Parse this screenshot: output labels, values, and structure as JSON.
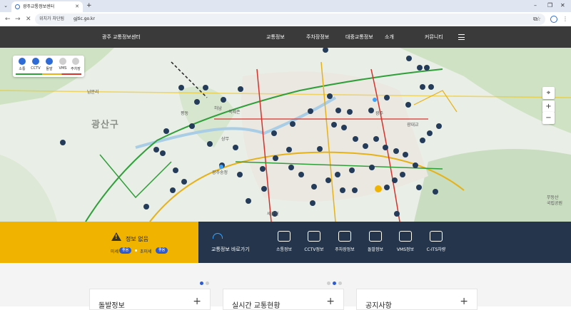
{
  "browser": {
    "tab_title": "광주교통정보센터",
    "url_site": "위치가 차단됨",
    "url": "gjtic.go.kr"
  },
  "site": {
    "logo": "광주 교통정보센터",
    "nav": [
      "교통정보",
      "주차장정보",
      "대중교통정보",
      "소개",
      "커뮤니티"
    ]
  },
  "map": {
    "area_label": "광산구",
    "legend": [
      {
        "label": "소통",
        "color": "#2f6bd6",
        "icon": "traffic-icon"
      },
      {
        "label": "CCTV",
        "color": "#2f6bd6",
        "icon": "cctv-icon"
      },
      {
        "label": "돌발",
        "color": "#2f6bd6",
        "icon": "incident-icon"
      },
      {
        "label": "VMS",
        "color": "#cfcfcf",
        "icon": "vms-icon"
      },
      {
        "label": "주차장",
        "color": "#cfcfcf",
        "icon": "parking-icon"
      }
    ],
    "place_labels": [
      "남문리",
      "평동",
      "하남",
      "국제존",
      "광주",
      "광주송정",
      "무등산",
      "국립공원",
      "광대교",
      "상무",
      "세광원"
    ]
  },
  "alert": {
    "title": "정보 없음",
    "fine_dust_label": "미세",
    "fine_dust_value": "좋음",
    "ultra_dust_label": "초미세",
    "ultra_dust_value": "좋음"
  },
  "quick": {
    "title": "교통정보 바로가기",
    "links": [
      {
        "label": "소통정보",
        "icon": "traffic-car-icon"
      },
      {
        "label": "CCTV정보",
        "icon": "cctv-camera-icon"
      },
      {
        "label": "주차장정보",
        "icon": "parking-icon"
      },
      {
        "label": "돌발정보",
        "icon": "incident-car-icon"
      },
      {
        "label": "VMS정보",
        "icon": "vms-sign-icon"
      },
      {
        "label": "C-ITS차량",
        "icon": "connected-car-icon"
      }
    ]
  },
  "cards": [
    {
      "title": "돌발정보"
    },
    {
      "title": "실시간 교통현황"
    },
    {
      "title": "공지사항"
    }
  ],
  "colors": {
    "header_bg": "#3a3a3a",
    "alert_bg": "#f0b400",
    "quick_bg": "#25364c",
    "badge": "#2f5bd0",
    "cctv_marker": "#243c5a"
  }
}
